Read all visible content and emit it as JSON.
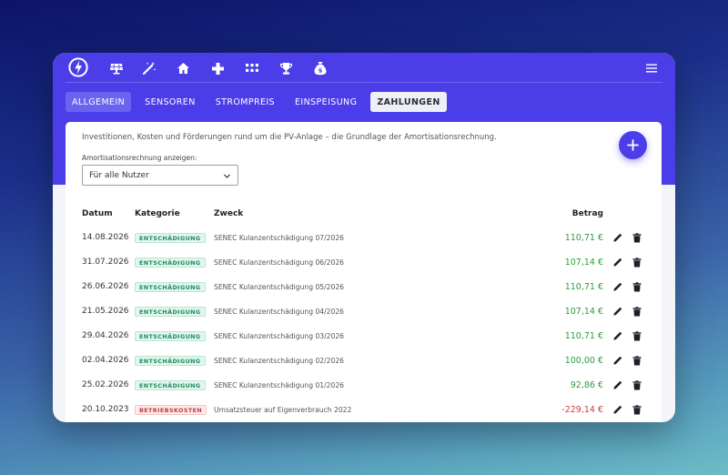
{
  "nav": {
    "icons": [
      "logo-icon",
      "solar-panel-icon",
      "magic-wand-icon",
      "home-icon",
      "plus-cross-icon",
      "grid-icon",
      "trophy-icon",
      "money-bag-icon",
      "menu-icon"
    ]
  },
  "tabs": [
    {
      "label": "ALLGEMEIN"
    },
    {
      "label": "SENSOREN"
    },
    {
      "label": "STROMPREIS"
    },
    {
      "label": "EINSPEISUNG"
    },
    {
      "label": "ZAHLUNGEN"
    }
  ],
  "content": {
    "description": "Investitionen, Kosten und Förderungen rund um die PV-Anlage – die Grundlage der Amortisationsrechnung.",
    "select_label": "Amortisationsrechnung anzeigen:",
    "select_value": "Für alle Nutzer"
  },
  "table": {
    "headers": {
      "date": "Datum",
      "category": "Kategorie",
      "purpose": "Zweck",
      "amount": "Betrag"
    },
    "rows": [
      {
        "date": "14.08.2026",
        "category": "ENTSCHÄDIGUNG",
        "purpose": "SENEC Kulanzentschädigung 07/2026",
        "amount": "110,71 €",
        "kind": "pos"
      },
      {
        "date": "31.07.2026",
        "category": "ENTSCHÄDIGUNG",
        "purpose": "SENEC Kulanzentschädigung 06/2026",
        "amount": "107,14 €",
        "kind": "pos"
      },
      {
        "date": "26.06.2026",
        "category": "ENTSCHÄDIGUNG",
        "purpose": "SENEC Kulanzentschädigung 05/2026",
        "amount": "110,71 €",
        "kind": "pos"
      },
      {
        "date": "21.05.2026",
        "category": "ENTSCHÄDIGUNG",
        "purpose": "SENEC Kulanzentschädigung 04/2026",
        "amount": "107,14 €",
        "kind": "pos"
      },
      {
        "date": "29.04.2026",
        "category": "ENTSCHÄDIGUNG",
        "purpose": "SENEC Kulanzentschädigung 03/2026",
        "amount": "110,71 €",
        "kind": "pos"
      },
      {
        "date": "02.04.2026",
        "category": "ENTSCHÄDIGUNG",
        "purpose": "SENEC Kulanzentschädigung 02/2026",
        "amount": "100,00 €",
        "kind": "pos"
      },
      {
        "date": "25.02.2026",
        "category": "ENTSCHÄDIGUNG",
        "purpose": "SENEC Kulanzentschädigung 01/2026",
        "amount": "92,86 €",
        "kind": "pos"
      },
      {
        "date": "20.10.2023",
        "category": "BETRIEBSKOSTEN",
        "purpose": "Umsatzsteuer auf Eigenverbrauch 2022",
        "amount": "-229,14 €",
        "kind": "neg"
      }
    ]
  },
  "colors": {
    "accent": "#4b3de8",
    "positive": "#2c9c3e",
    "negative": "#d23b3b"
  }
}
